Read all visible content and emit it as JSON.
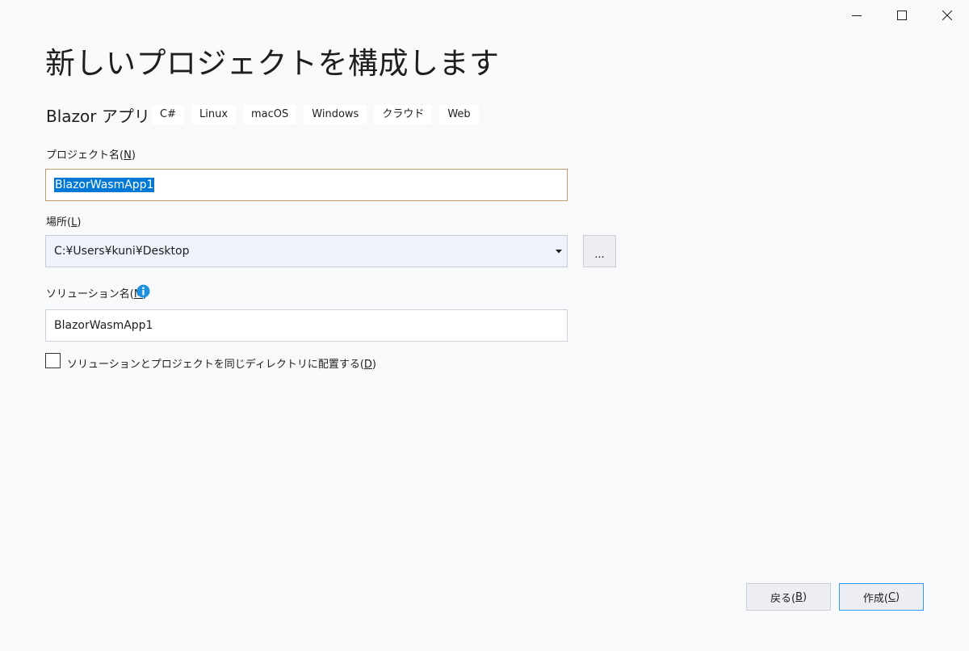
{
  "window": {
    "controls": [
      "minimize-icon",
      "maximize-icon",
      "close-icon"
    ]
  },
  "page_title": "新しいプロジェクトを構成します",
  "template": {
    "name": "Blazor アプリ",
    "tags": [
      "C#",
      "Linux",
      "macOS",
      "Windows",
      "クラウド",
      "Web"
    ]
  },
  "project_name": {
    "label": "プロジェクト名(",
    "accelerator": "N",
    "label_end": ")",
    "value": "BlazorWasmApp1"
  },
  "location": {
    "label": "場所(",
    "accelerator": "L",
    "label_end": ")",
    "value": "C:¥Users¥kuni¥Desktop",
    "browse_label": "..."
  },
  "solution_name": {
    "label": "ソリューション名(",
    "accelerator": "M",
    "label_end": ")",
    "value": "BlazorWasmApp1",
    "info_icon": "info-icon"
  },
  "same_directory": {
    "label": "ソリューションとプロジェクトを同じディレクトリに配置する(",
    "accelerator": "D",
    "label_end": ")",
    "checked": false
  },
  "footer": {
    "back": {
      "label": "戻る(",
      "accelerator": "B",
      "label_end": ")"
    },
    "create": {
      "label": "作成(",
      "accelerator": "C",
      "label_end": ")"
    }
  },
  "colors": {
    "background": "#f8f9fb",
    "accent": "#0078d7",
    "focus_border": "#3399ff",
    "info": "#1e90e0"
  }
}
